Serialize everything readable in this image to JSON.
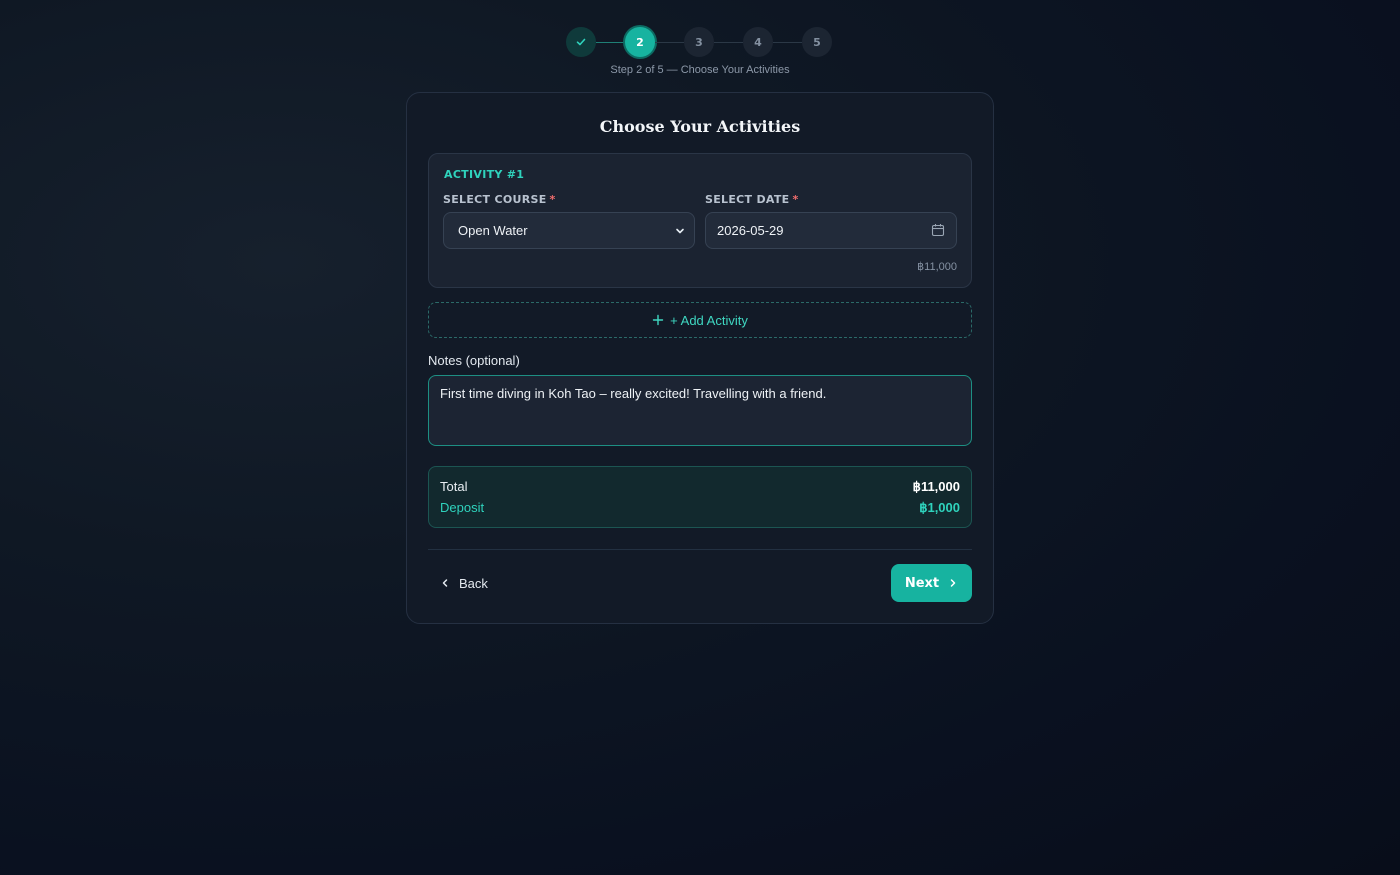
{
  "stepper": {
    "steps": [
      {
        "label": "",
        "state": "done",
        "icon": "check-icon"
      },
      {
        "label": "2",
        "state": "active"
      },
      {
        "label": "3",
        "state": "todo"
      },
      {
        "label": "4",
        "state": "todo"
      },
      {
        "label": "5",
        "state": "todo"
      }
    ],
    "caption": "Step 2 of 5 — Choose Your Activities"
  },
  "card": {
    "title": "Choose Your Activities",
    "activity": {
      "label": "ACTIVITY #1",
      "course_label": "SELECT COURSE",
      "course_value": "Open Water",
      "date_label": "SELECT DATE",
      "date_value": "2026-05-29",
      "required_mark": "*",
      "price": "฿11,000"
    },
    "add_activity_label": "+ Add Activity",
    "notes_label": "Notes (optional)",
    "notes_value": "First time diving in Koh Tao – really excited! Travelling with a friend.",
    "totals": {
      "total_label": "Total",
      "total_value": "฿11,000",
      "deposit_label": "Deposit",
      "deposit_value": "฿1,000"
    },
    "back_label": "Back",
    "next_label": "Next"
  },
  "colors": {
    "accent": "#17b3a0",
    "accent_text": "#2fd3bd",
    "background": "#0b1220",
    "required": "#f26d6d"
  }
}
